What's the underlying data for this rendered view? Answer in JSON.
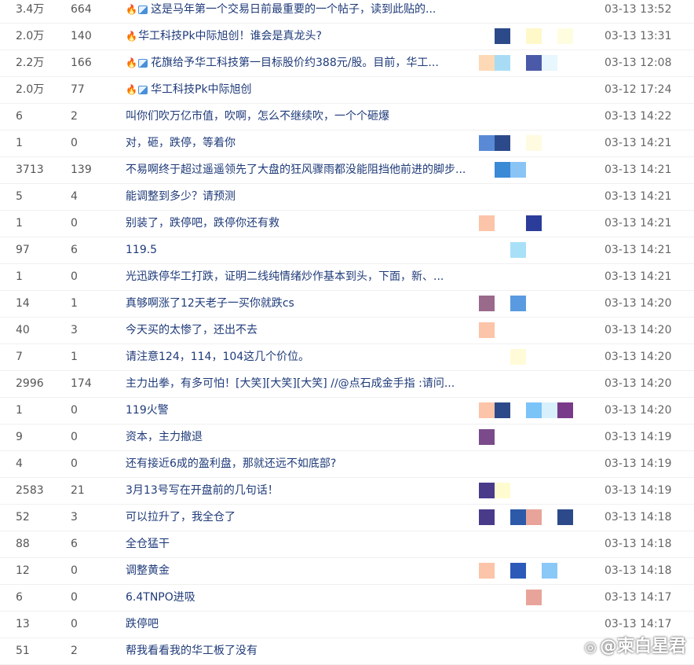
{
  "rows": [
    {
      "reads": "3.4万",
      "replies": "664",
      "hot": true,
      "img": true,
      "title": "这是马年第一个交易日前最重要的一个帖子，读到此贴的...",
      "time": "03-13 13:52",
      "avatars": []
    },
    {
      "reads": "2.0万",
      "replies": "140",
      "hot": true,
      "img": false,
      "title": "华工科技Pk中际旭创！谁会是真龙头?",
      "time": "03-13 13:31",
      "avatars": [
        {
          "slot": 1,
          "color": "#2c4a8a"
        },
        {
          "slot": 3,
          "color": "#fff8c8"
        },
        {
          "slot": 5,
          "color": "#fffde0"
        }
      ]
    },
    {
      "reads": "2.2万",
      "replies": "166",
      "hot": true,
      "img": true,
      "title": "花旗给予华工科技第一目标股价约388元/股。目前，华工...",
      "time": "03-13 12:08",
      "avatars": [
        {
          "slot": 0,
          "color": "#fdd9b5"
        },
        {
          "slot": 1,
          "color": "#a8dcf5"
        },
        {
          "slot": 3,
          "color": "#4a5aa8"
        },
        {
          "slot": 4,
          "color": "#e8f6fd"
        }
      ]
    },
    {
      "reads": "2.0万",
      "replies": "77",
      "hot": true,
      "img": true,
      "title": "华工科技Pk中际旭创",
      "time": "03-12 17:24",
      "avatars": []
    },
    {
      "reads": "6",
      "replies": "2",
      "hot": false,
      "img": false,
      "title": "叫你们吹万亿市值，吹啊，怎么不继续吹，一个个砸爆",
      "time": "03-13 14:22",
      "avatars": []
    },
    {
      "reads": "1",
      "replies": "0",
      "hot": false,
      "img": false,
      "title": "对，砸，跌停，等着你",
      "time": "03-13 14:21",
      "avatars": [
        {
          "slot": 0,
          "color": "#5a8ad6"
        },
        {
          "slot": 1,
          "color": "#2c4a8a"
        },
        {
          "slot": 3,
          "color": "#fffbe0"
        }
      ]
    },
    {
      "reads": "3713",
      "replies": "139",
      "hot": false,
      "img": false,
      "title": "不易啊终于超过遥遥领先了大盘的狂风骤雨都没能阻挡他前进的脚步...",
      "time": "03-13 14:21",
      "avatars": [
        {
          "slot": 1,
          "color": "#3a8ad6"
        },
        {
          "slot": 2,
          "color": "#8ac4f5"
        }
      ]
    },
    {
      "reads": "5",
      "replies": "4",
      "hot": false,
      "img": false,
      "title": "能调整到多少？请预测",
      "time": "03-13 14:21",
      "avatars": []
    },
    {
      "reads": "1",
      "replies": "0",
      "hot": false,
      "img": false,
      "title": "别装了，跌停吧，跌停你还有救",
      "time": "03-13 14:21",
      "avatars": [
        {
          "slot": 0,
          "color": "#fcc4a8"
        },
        {
          "slot": 3,
          "color": "#2c3c9a"
        }
      ]
    },
    {
      "reads": "97",
      "replies": "6",
      "hot": false,
      "img": false,
      "title": "119.5",
      "time": "03-13 14:21",
      "avatars": [
        {
          "slot": 2,
          "color": "#a8e0f8"
        }
      ]
    },
    {
      "reads": "1",
      "replies": "0",
      "hot": false,
      "img": false,
      "title": "光迅跌停华工打跌，证明二线纯情绪炒作基本到头，下面，新、...",
      "time": "03-13 14:21",
      "avatars": []
    },
    {
      "reads": "14",
      "replies": "1",
      "hot": false,
      "img": false,
      "title": "真够啊涨了12天老子一买你就跌cs",
      "time": "03-13 14:20",
      "avatars": [
        {
          "slot": 0,
          "color": "#9a6a8a"
        },
        {
          "slot": 2,
          "color": "#5a9ae0"
        }
      ]
    },
    {
      "reads": "40",
      "replies": "3",
      "hot": false,
      "img": false,
      "title": "今天买的太惨了，还出不去",
      "time": "03-13 14:20",
      "avatars": [
        {
          "slot": 0,
          "color": "#fcc4a8"
        }
      ]
    },
    {
      "reads": "7",
      "replies": "1",
      "hot": false,
      "img": false,
      "title": "请注意124，114，104这几个价位。",
      "time": "03-13 14:20",
      "avatars": [
        {
          "slot": 2,
          "color": "#fffbd8"
        }
      ]
    },
    {
      "reads": "2996",
      "replies": "174",
      "hot": false,
      "img": false,
      "title": "主力出拳，有多可怕！[大笑][大笑][大笑] //@点石成金手指 :请问...",
      "time": "03-13 14:20",
      "avatars": []
    },
    {
      "reads": "1",
      "replies": "0",
      "hot": false,
      "img": false,
      "title": "119火警",
      "time": "03-13 14:20",
      "avatars": [
        {
          "slot": 0,
          "color": "#fcc4a8"
        },
        {
          "slot": 1,
          "color": "#2c4a8a"
        },
        {
          "slot": 3,
          "color": "#7ac4f8"
        },
        {
          "slot": 4,
          "color": "#d8f0fc"
        },
        {
          "slot": 5,
          "color": "#7a3a8a"
        }
      ]
    },
    {
      "reads": "9",
      "replies": "0",
      "hot": false,
      "img": false,
      "title": "资本，主力撤退",
      "time": "03-13 14:19",
      "avatars": [
        {
          "slot": 0,
          "color": "#7a4a8a"
        }
      ]
    },
    {
      "reads": "4",
      "replies": "0",
      "hot": false,
      "img": false,
      "title": "还有接近6成的盈利盘，那就还远不如底部?",
      "time": "03-13 14:19",
      "avatars": []
    },
    {
      "reads": "2583",
      "replies": "21",
      "hot": false,
      "img": false,
      "title": "3月13号写在开盘前的几句话！",
      "time": "03-13 14:19",
      "avatars": [
        {
          "slot": 0,
          "color": "#4a3a8a"
        },
        {
          "slot": 1,
          "color": "#fffbd0"
        }
      ]
    },
    {
      "reads": "52",
      "replies": "3",
      "hot": false,
      "img": false,
      "title": "可以拉升了，我全仓了",
      "time": "03-13 14:18",
      "avatars": [
        {
          "slot": 0,
          "color": "#4a3a8a"
        },
        {
          "slot": 2,
          "color": "#2c5aa8"
        },
        {
          "slot": 3,
          "color": "#e8a49a"
        },
        {
          "slot": 5,
          "color": "#2c4a8a"
        }
      ]
    },
    {
      "reads": "88",
      "replies": "6",
      "hot": false,
      "img": false,
      "title": "全仓猛干",
      "time": "03-13 14:18",
      "avatars": []
    },
    {
      "reads": "12",
      "replies": "0",
      "hot": false,
      "img": false,
      "title": "调整黄金",
      "time": "03-13 14:18",
      "avatars": [
        {
          "slot": 0,
          "color": "#fcc4a8"
        },
        {
          "slot": 2,
          "color": "#2c5ab8"
        },
        {
          "slot": 4,
          "color": "#8ac8f8"
        }
      ]
    },
    {
      "reads": "6",
      "replies": "0",
      "hot": false,
      "img": false,
      "title": "6.4TNPO进吸",
      "time": "03-13 14:17",
      "avatars": [
        {
          "slot": 3,
          "color": "#e8a49a"
        }
      ]
    },
    {
      "reads": "13",
      "replies": "0",
      "hot": false,
      "img": false,
      "title": "跌停吧",
      "time": "03-13 14:17",
      "avatars": []
    },
    {
      "reads": "51",
      "replies": "2",
      "hot": false,
      "img": false,
      "title": "帮我看看我的华工板了没有",
      "time": "",
      "avatars": []
    }
  ],
  "watermark": {
    "text": "@柬白星君"
  }
}
